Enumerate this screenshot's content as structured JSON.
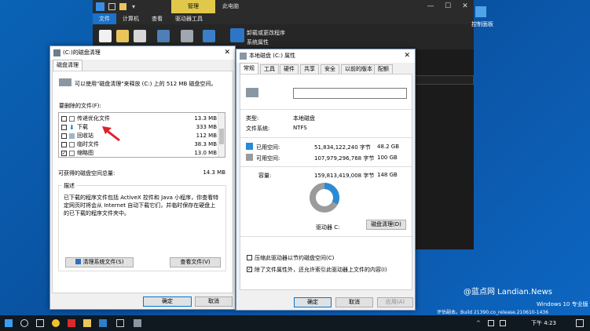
{
  "explorer": {
    "context_tab": "管理",
    "title": "此电脑",
    "controls": [
      "—",
      "☐",
      "✕"
    ],
    "tabs": [
      "文件",
      "计算机",
      "查看",
      "驱动器工具"
    ],
    "ribbon_links": [
      "卸载或更改程序",
      "系统属性"
    ]
  },
  "desktop": {
    "icon_label": "控制面板"
  },
  "cleanup": {
    "title": "(C:)的磁盘清理",
    "tab": "磁盘清理",
    "summary": "可以使用\"磁盘清理\"来释放 (C:) 上的 512 MB 磁盘空间。",
    "files_label": "要删除的文件(F):",
    "files": [
      {
        "name": "传递优化文件",
        "size": "13.3 MB",
        "checked": false
      },
      {
        "name": "下载",
        "size": "333 MB",
        "checked": false
      },
      {
        "name": "回收站",
        "size": "112 MB",
        "checked": false
      },
      {
        "name": "临时文件",
        "size": "38.3 MB",
        "checked": false
      },
      {
        "name": "缩略图",
        "size": "13.0 MB",
        "checked": true
      }
    ],
    "total_label": "可获得的磁盘空间总量:",
    "total_value": "14.3 MB",
    "desc_title": "描述",
    "desc_text": "已下载的程序文件包括 ActiveX 控件和 Java 小程序，你查看特定网页时将会从 Internet 自动下载它们，并临时保存在硬盘上的已下载的程序文件夹中。",
    "btn_system": "清理系统文件(S)",
    "btn_view": "查看文件(V)",
    "btn_ok": "确定",
    "btn_cancel": "取消",
    "colors": {
      "accent": "#0078d7",
      "arrow": "#e0202a"
    }
  },
  "props": {
    "title": "本地磁盘 (C:) 属性",
    "tabs": [
      "常规",
      "工具",
      "硬件",
      "共享",
      "安全",
      "以前的版本",
      "配额"
    ],
    "type_label": "类型:",
    "type_value": "本地磁盘",
    "fs_label": "文件系统:",
    "fs_value": "NTFS",
    "used_label": "已用空间:",
    "used_bytes": "51,834,122,240 字节",
    "used_gb": "48.2 GB",
    "free_label": "可用空间:",
    "free_bytes": "107,979,296,768 字节",
    "free_gb": "100 GB",
    "cap_label": "容量:",
    "cap_bytes": "159,813,419,008 字节",
    "cap_gb": "148 GB",
    "drive_label": "驱动器 C:",
    "btn_cleanup": "磁盘清理(D)",
    "compress_label": "压缩此驱动器以节约磁盘空间(C)",
    "compress_checked": false,
    "index_label": "除了文件属性外，还允许索引此驱动器上文件的内容(I)",
    "index_checked": true,
    "btn_ok": "确定",
    "btn_cancel": "取消",
    "btn_apply": "应用(A)",
    "used_fraction": 0.324,
    "colors": {
      "used": "#2a8ad6",
      "free": "#9b9b9b"
    }
  },
  "watermark": {
    "site": "@蓝点网 Landian.News",
    "os": "Windows 10 专业版",
    "build": "评估副本。Build 21390.co_release.210610-1436"
  },
  "taskbar": {
    "time": "下午 4:23"
  }
}
